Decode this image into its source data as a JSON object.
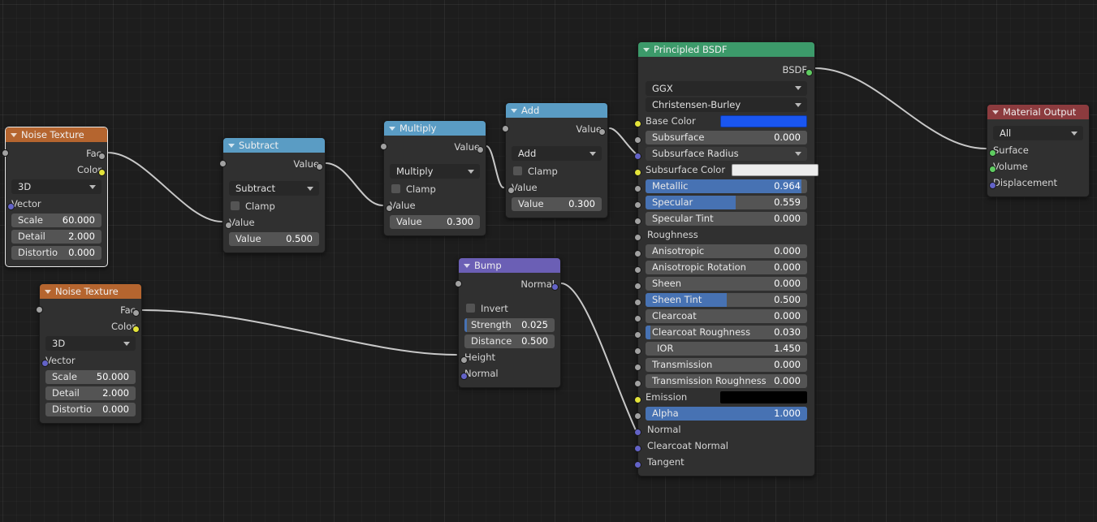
{
  "editor": {
    "name": "Shader Node Editor",
    "background": "#1d1d1d",
    "grid": "on"
  },
  "colors": {
    "header_texture": "#b5652f",
    "header_converter": "#5a9cc4",
    "header_shader": "#3c9a6a",
    "header_vector": "#6b5fb5",
    "header_output": "#8c3b3e",
    "slider_fill": "#4772b3",
    "link": "#c8c8c8",
    "socket_value": "#a1a1a1",
    "socket_color": "#e3e33a",
    "socket_vector": "#6363c7",
    "socket_shader": "#5fcc61"
  },
  "nodes": {
    "noise1": {
      "title": "Noise Texture",
      "selected": true,
      "outputs": [
        "Fac",
        "Color"
      ],
      "dropdown": "3D",
      "inputs": [
        "Vector"
      ],
      "fields": [
        {
          "name": "Scale",
          "value": "60.000"
        },
        {
          "name": "Detail",
          "value": "2.000"
        },
        {
          "name": "Distortio",
          "value": "0.000"
        }
      ]
    },
    "noise2": {
      "title": "Noise Texture",
      "selected": false,
      "outputs": [
        "Fac",
        "Color"
      ],
      "dropdown": "3D",
      "inputs": [
        "Vector"
      ],
      "fields": [
        {
          "name": "Scale",
          "value": "50.000"
        },
        {
          "name": "Detail",
          "value": "2.000"
        },
        {
          "name": "Distortio",
          "value": "0.000"
        }
      ]
    },
    "subtract": {
      "title": "Subtract",
      "output": "Value",
      "operation": "Subtract",
      "clamp_label": "Clamp",
      "clamp_checked": false,
      "input_label": "Value",
      "field": {
        "name": "Value",
        "value": "0.500"
      }
    },
    "multiply": {
      "title": "Multiply",
      "output": "Value",
      "operation": "Multiply",
      "clamp_label": "Clamp",
      "clamp_checked": false,
      "input_label": "Value",
      "field": {
        "name": "Value",
        "value": "0.300"
      }
    },
    "add": {
      "title": "Add",
      "output": "Value",
      "operation": "Add",
      "clamp_label": "Clamp",
      "clamp_checked": false,
      "input_label": "Value",
      "field": {
        "name": "Value",
        "value": "0.300"
      }
    },
    "bump": {
      "title": "Bump",
      "output": "Normal",
      "invert_label": "Invert",
      "invert_checked": false,
      "fields": [
        {
          "name": "Strength",
          "value": "0.025",
          "fill_pct": 2.5
        },
        {
          "name": "Distance",
          "value": "0.500",
          "fill_pct": 0
        }
      ],
      "inputs": [
        "Height",
        "Normal"
      ]
    },
    "bsdf": {
      "title": "Principled BSDF",
      "output": "BSDF",
      "distribution": "GGX",
      "subsurface_method": "Christensen-Burley",
      "rows": [
        {
          "label": "Base Color",
          "kind": "swatch",
          "color": "#1a56f0",
          "socket": "color"
        },
        {
          "label": "Subsurface",
          "kind": "slider",
          "value": "0.000",
          "fill_pct": 0,
          "socket": "value"
        },
        {
          "label": "Subsurface Radius",
          "kind": "dropdown",
          "socket": "vector"
        },
        {
          "label": "Subsurface Color",
          "kind": "swatch",
          "color": "#ececec",
          "socket": "color"
        },
        {
          "label": "Metallic",
          "kind": "slider",
          "value": "0.964",
          "fill_pct": 96.4,
          "socket": "value"
        },
        {
          "label": "Specular",
          "kind": "slider",
          "value": "0.559",
          "fill_pct": 55.9,
          "socket": "value"
        },
        {
          "label": "Specular Tint",
          "kind": "slider",
          "value": "0.000",
          "fill_pct": 0,
          "socket": "value"
        },
        {
          "label": "Roughness",
          "kind": "plain",
          "socket": "value"
        },
        {
          "label": "Anisotropic",
          "kind": "slider",
          "value": "0.000",
          "fill_pct": 0,
          "socket": "value"
        },
        {
          "label": "Anisotropic Rotation",
          "kind": "slider",
          "value": "0.000",
          "fill_pct": 0,
          "socket": "value"
        },
        {
          "label": "Sheen",
          "kind": "slider",
          "value": "0.000",
          "fill_pct": 0,
          "socket": "value"
        },
        {
          "label": "Sheen Tint",
          "kind": "slider",
          "value": "0.500",
          "fill_pct": 50,
          "socket": "value"
        },
        {
          "label": "Clearcoat",
          "kind": "slider",
          "value": "0.000",
          "fill_pct": 0,
          "socket": "value"
        },
        {
          "label": "Clearcoat Roughness",
          "kind": "slider",
          "value": "0.030",
          "fill_pct": 3,
          "socket": "value"
        },
        {
          "label": "IOR",
          "kind": "slider",
          "value": "1.450",
          "fill_pct": 0,
          "socket": "value",
          "center": true
        },
        {
          "label": "Transmission",
          "kind": "slider",
          "value": "0.000",
          "fill_pct": 0,
          "socket": "value"
        },
        {
          "label": "Transmission Roughness",
          "kind": "slider",
          "value": "0.000",
          "fill_pct": 0,
          "socket": "value"
        },
        {
          "label": "Emission",
          "kind": "swatch",
          "color": "#000000",
          "socket": "color"
        },
        {
          "label": "Alpha",
          "kind": "slider",
          "value": "1.000",
          "fill_pct": 100,
          "socket": "value"
        },
        {
          "label": "Normal",
          "kind": "plain",
          "socket": "vector"
        },
        {
          "label": "Clearcoat Normal",
          "kind": "plain",
          "socket": "vector"
        },
        {
          "label": "Tangent",
          "kind": "plain",
          "socket": "vector"
        }
      ]
    },
    "output": {
      "title": "Material Output",
      "dropdown": "All",
      "inputs": [
        {
          "label": "Surface",
          "socket": "shader"
        },
        {
          "label": "Volume",
          "socket": "shader"
        },
        {
          "label": "Displacement",
          "socket": "vector"
        }
      ]
    }
  }
}
